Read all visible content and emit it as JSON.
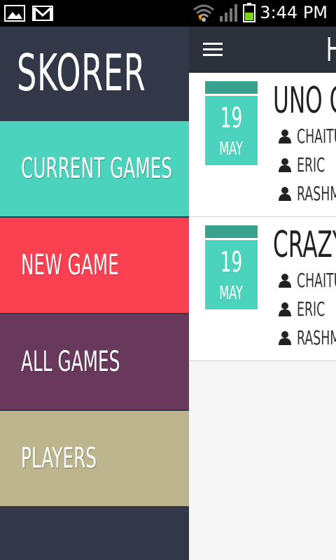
{
  "status_bar": {
    "time": "3:44 PM",
    "left_icons": [
      "gallery-notification-icon",
      "gmail-notification-icon"
    ],
    "right_icons": [
      "wifi-icon",
      "signal-icon",
      "battery-icon"
    ]
  },
  "drawer": {
    "brand": "SKORER",
    "items": [
      {
        "label": "CURRENT GAMES",
        "color": "#4cd3bd"
      },
      {
        "label": "NEW GAME",
        "color": "#fb4151"
      },
      {
        "label": "ALL GAMES",
        "color": "#68385d"
      },
      {
        "label": "PLAYERS",
        "color": "#bcb58d"
      }
    ]
  },
  "app_bar": {
    "title": "H",
    "menu_icon": "hamburger-icon"
  },
  "games": [
    {
      "title": "UNO GA",
      "date_day": "19",
      "date_month": "MAY",
      "players": [
        "CHAITU",
        "ERIC",
        "RASHMI"
      ]
    },
    {
      "title": "CRAZY",
      "date_day": "19",
      "date_month": "MAY",
      "players": [
        "CHAITU",
        "ERIC",
        "RASHMI"
      ]
    }
  ],
  "colors": {
    "drawer_bg": "#323848",
    "app_bar_bg": "#2c313c",
    "date_accent": "#4cd3bd",
    "date_tab": "#39a18d"
  }
}
